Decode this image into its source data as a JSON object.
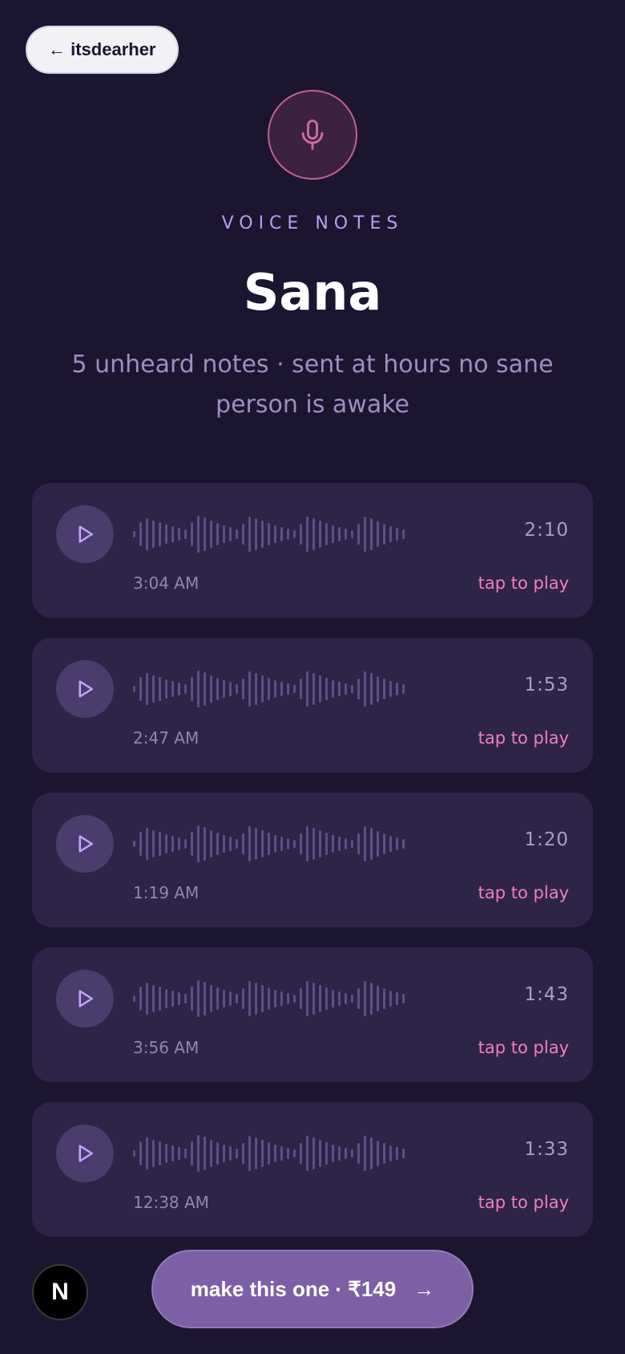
{
  "back": {
    "label": "← itsdearher"
  },
  "header": {
    "kicker": "VOICE NOTES",
    "name": "Sana",
    "subtitle": "5 unheard notes · sent at hours no sane person is awake"
  },
  "notes": [
    {
      "duration": "2:10",
      "time": "3:04 AM",
      "action": "tap to play"
    },
    {
      "duration": "1:53",
      "time": "2:47 AM",
      "action": "tap to play"
    },
    {
      "duration": "1:20",
      "time": "1:19 AM",
      "action": "tap to play"
    },
    {
      "duration": "1:43",
      "time": "3:56 AM",
      "action": "tap to play"
    },
    {
      "duration": "1:33",
      "time": "12:38 AM",
      "action": "tap to play"
    }
  ],
  "badge": {
    "label": "N"
  },
  "cta": {
    "label": "make this one · ₹149",
    "arrow": "→"
  },
  "colors": {
    "background": "#1c1530",
    "card": "#2e2448",
    "accent_pink": "#f27fbd",
    "accent_purple": "#b89ff0",
    "cta": "#7d5fa6"
  },
  "icons": [
    "microphone-icon",
    "play-icon",
    "arrow-right-icon"
  ]
}
